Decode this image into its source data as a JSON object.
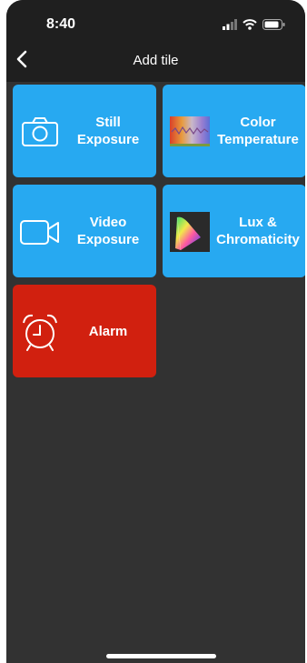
{
  "status_bar": {
    "time": "8:40"
  },
  "nav": {
    "title": "Add tile"
  },
  "tiles": [
    {
      "label": "Still\nExposure",
      "color": "#27a9f1",
      "icon": "camera-icon"
    },
    {
      "label": "Color\nTemperature",
      "color": "#27a9f1",
      "icon": "color-temperature-icon"
    },
    {
      "label": "Video\nExposure",
      "color": "#27a9f1",
      "icon": "video-camera-icon"
    },
    {
      "label": "Lux &\nChromaticity",
      "color": "#27a9f1",
      "icon": "chromaticity-icon"
    },
    {
      "label": "Alarm",
      "color": "#d1200f",
      "icon": "alarm-clock-icon"
    }
  ],
  "colors": {
    "background": "#323232",
    "bars": "#1f1f1f"
  }
}
